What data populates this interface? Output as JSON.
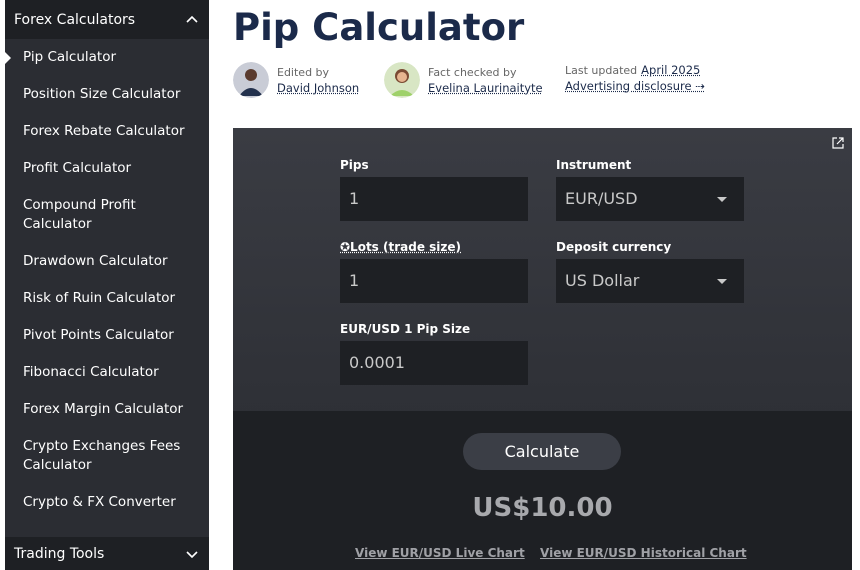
{
  "sidebar": {
    "header_label": "Forex Calculators",
    "items": [
      {
        "label": "Pip Calculator",
        "active": true
      },
      {
        "label": "Position Size Calculator"
      },
      {
        "label": "Forex Rebate Calculator"
      },
      {
        "label": "Profit Calculator"
      },
      {
        "label": "Compound Profit Calculator"
      },
      {
        "label": "Drawdown Calculator"
      },
      {
        "label": "Risk of Ruin Calculator"
      },
      {
        "label": "Pivot Points Calculator"
      },
      {
        "label": "Fibonacci Calculator"
      },
      {
        "label": "Forex Margin Calculator"
      },
      {
        "label": "Crypto Exchanges Fees Calculator"
      },
      {
        "label": "Crypto & FX Converter"
      }
    ],
    "footer_label": "Trading Tools"
  },
  "page": {
    "title": "Pip Calculator",
    "editor": {
      "label": "Edited by",
      "name": "David Johnson"
    },
    "fact_checker": {
      "label": "Fact checked by",
      "name": "Evelina Laurinaityte"
    },
    "updated": {
      "label": "Last updated",
      "date": "April 2025"
    },
    "advertising_label": "Advertising disclosure ⇢"
  },
  "calculator": {
    "pips": {
      "label": "Pips",
      "value": "1"
    },
    "instrument": {
      "label": "Instrument",
      "value": "EUR/USD"
    },
    "lots": {
      "label": "✪Lots (trade size)",
      "value": "1"
    },
    "deposit_currency": {
      "label": "Deposit currency",
      "value": "US Dollar"
    },
    "pip_size": {
      "label": "EUR/USD 1 Pip Size",
      "value": "0.0001"
    },
    "calculate_label": "Calculate",
    "result": "US$10.00",
    "live_chart_label": "View EUR/USD Live Chart",
    "historical_chart_label": "View EUR/USD Historical Chart"
  },
  "colors": {
    "sidebar_bg": "#2b2d33",
    "sidebar_header_bg": "#1e2024",
    "title": "#1b2a4a",
    "calc_bg": "#35373d",
    "field_bg": "#1e2024"
  }
}
